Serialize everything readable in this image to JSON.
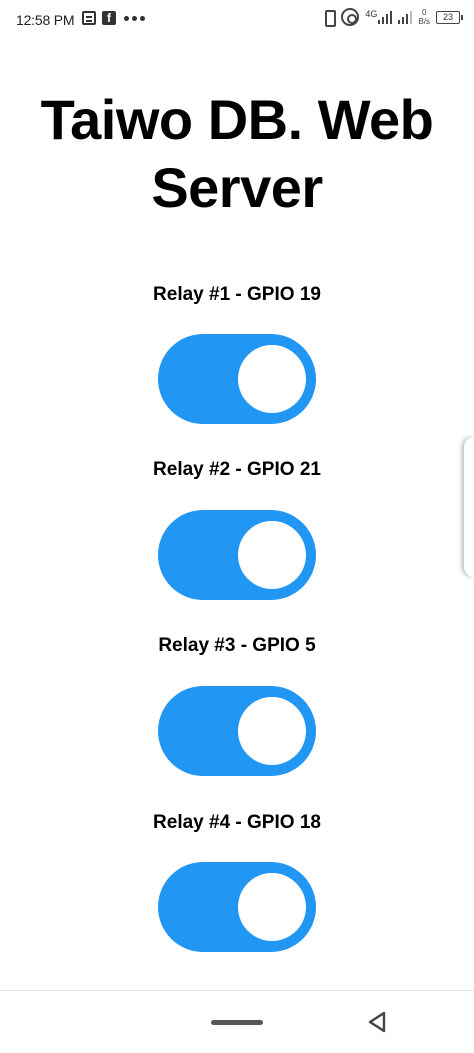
{
  "status_bar": {
    "time": "12:58 PM",
    "left_icons": [
      "message-icon",
      "facebook-icon",
      "more-dots-icon"
    ],
    "facebook_glyph": "f",
    "network": "4G",
    "speed_value": "0",
    "speed_unit": "B/s",
    "battery": "23"
  },
  "page": {
    "title": "Taiwo DB. Web Server"
  },
  "relays": [
    {
      "label": "Relay #1 - GPIO 19",
      "state": "on"
    },
    {
      "label": "Relay #2 - GPIO 21",
      "state": "on"
    },
    {
      "label": "Relay #3 - GPIO 5",
      "state": "on"
    },
    {
      "label": "Relay #4 - GPIO 18",
      "state": "on"
    }
  ],
  "colors": {
    "switch_on": "#2196f3",
    "knob": "#ffffff",
    "background": "#ffffff",
    "text": "#000000"
  }
}
